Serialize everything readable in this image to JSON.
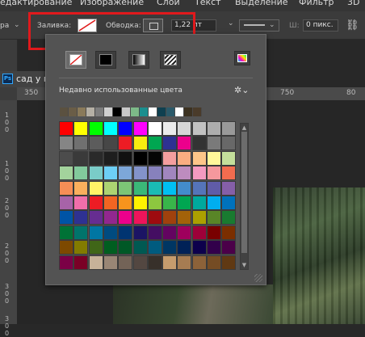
{
  "menubar": {
    "items": [
      "едактирование",
      "Изображение",
      "Слои",
      "Текст",
      "Выделение",
      "Фильтр",
      "3D"
    ]
  },
  "options": {
    "left_cut": "ра",
    "fill_label": "Заливка:",
    "stroke_label": "Обводка:",
    "stroke_width": "1,22 пт",
    "width_label": "Ш:",
    "width_value": "0 пикс.",
    "link_icon": "link-icon"
  },
  "document": {
    "ps_badge": "Ps",
    "title": "сад у п"
  },
  "ruler": {
    "top_labels": [
      "350",
      "4",
      "750",
      "80"
    ],
    "left_labels": [
      "1\n0\n0",
      "1\n0\n0",
      "2\n0\n0",
      "2\n0\n0",
      "3\n0\n0",
      "3\n0\n0"
    ]
  },
  "panel": {
    "recent_label": "Недавно использованные цвета",
    "fill_types": [
      "no-color",
      "solid-color",
      "gradient",
      "pattern"
    ],
    "selected_fill": "no-color",
    "recent_colors": [
      "#5b5140",
      "#6a5d47",
      "#8a7a5a",
      "#b5b0a5",
      "#7d7d7d",
      "#d0d0d0",
      "#000000",
      "#c8c8c8",
      "#7dba88",
      "#1b8f8f",
      "#ffffff",
      "#0f4050",
      "#2b5a6a",
      "#ffffff",
      "#3c3221",
      "#4a3b2a"
    ],
    "swatch_rows": [
      [
        "#ff0000",
        "#ffff00",
        "#00ff00",
        "#00ffff",
        "#0000ff",
        "#ff00ff",
        "#ffffff",
        "#ebebeb",
        "#d6d6d6",
        "#c2c2c2",
        "#adadad",
        "#999999"
      ],
      [
        "#858585",
        "#707070",
        "#5c5c5c",
        "#474747",
        "#ed1c24",
        "#f7ec0f",
        "#00a651",
        "#2e3192",
        "#ec008c",
        "#333333",
        "#7a7a7a",
        "#686868"
      ],
      [
        "#4c4c4c",
        "#3a3a3a",
        "#2a2a2a",
        "#1e1e1e",
        "#111111",
        "#000000",
        "#050505",
        "#f49e9e",
        "#f9ad81",
        "#fdc689",
        "#fff79a",
        "#c4df9b"
      ],
      [
        "#a3d39c",
        "#82ca9c",
        "#7accc8",
        "#6dcff6",
        "#7da7d9",
        "#8393ca",
        "#8781bd",
        "#a186be",
        "#bd8cbf",
        "#f49ac1",
        "#f5989d",
        "#f26c4f"
      ],
      [
        "#f68e56",
        "#fbaf5d",
        "#fff467",
        "#acd372",
        "#7cc576",
        "#3bb878",
        "#1abbb4",
        "#00bff3",
        "#438ccb",
        "#5574b9",
        "#605ca8",
        "#855fa8"
      ],
      [
        "#a763a8",
        "#f06eaa",
        "#ed1c24",
        "#f26522",
        "#f7941d",
        "#fff200",
        "#8dc73f",
        "#39b54a",
        "#00a651",
        "#00a99d",
        "#00aeef",
        "#0072bc"
      ],
      [
        "#0054a6",
        "#2e3192",
        "#662d91",
        "#92278f",
        "#ec008c",
        "#ed145b",
        "#9e0b0f",
        "#a0410d",
        "#a36209",
        "#aba000",
        "#598527",
        "#197b30"
      ],
      [
        "#007236",
        "#00746b",
        "#0076a3",
        "#004b80",
        "#003471",
        "#1b1464",
        "#440e62",
        "#630460",
        "#9e005d",
        "#9e0039",
        "#790000",
        "#7b2e00"
      ],
      [
        "#7d4900",
        "#827b00",
        "#406618",
        "#005e20",
        "#005826",
        "#005952",
        "#005b7f",
        "#003663",
        "#002157",
        "#0d004c",
        "#32004b",
        "#4b0049"
      ],
      [
        "#7b0046",
        "#7a0026",
        "#c7b299",
        "#998675",
        "#736357",
        "#534741",
        "#37302a",
        "#c69c6d",
        "#a67c52",
        "#8c6239",
        "#754c24",
        "#603913"
      ]
    ]
  }
}
